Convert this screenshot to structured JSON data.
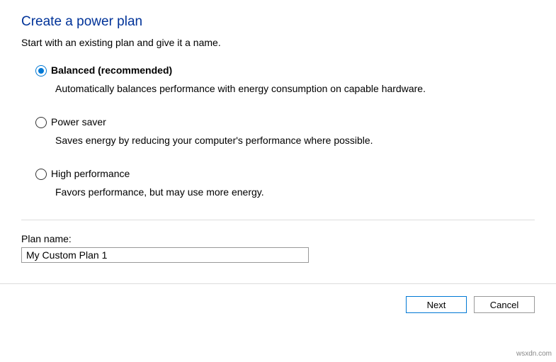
{
  "title": "Create a power plan",
  "subtitle": "Start with an existing plan and give it a name.",
  "options": [
    {
      "label": "Balanced (recommended)",
      "description": "Automatically balances performance with energy consumption on capable hardware.",
      "selected": true
    },
    {
      "label": "Power saver",
      "description": "Saves energy by reducing your computer's performance where possible.",
      "selected": false
    },
    {
      "label": "High performance",
      "description": "Favors performance, but may use more energy.",
      "selected": false
    }
  ],
  "plan_name": {
    "label": "Plan name:",
    "value": "My Custom Plan 1"
  },
  "buttons": {
    "next": "Next",
    "cancel": "Cancel"
  },
  "watermark": "wsxdn.com"
}
